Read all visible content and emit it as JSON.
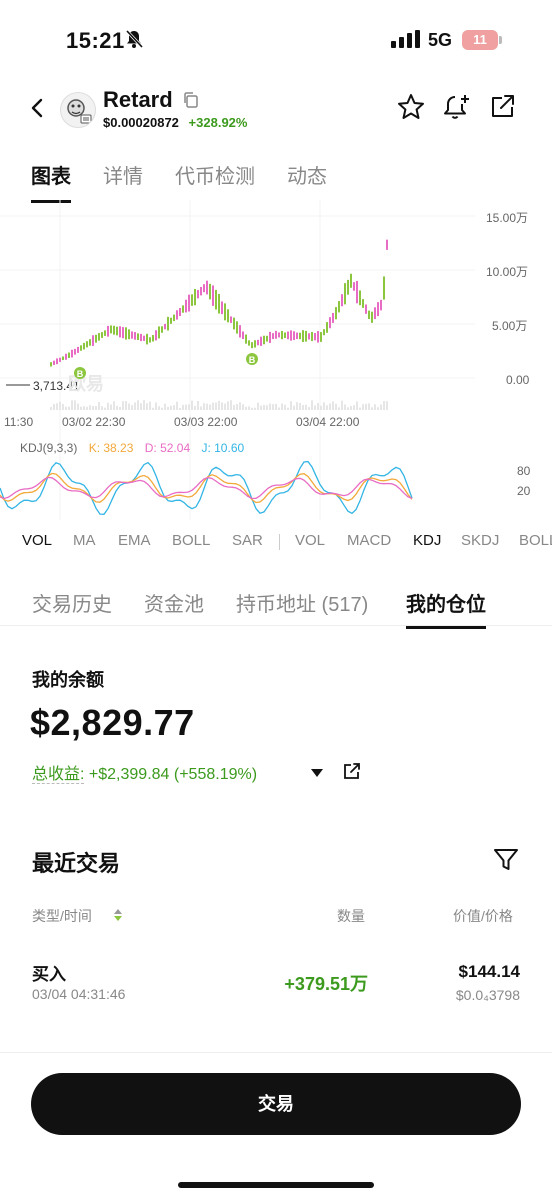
{
  "status_bar": {
    "time": "15:21",
    "network": "5G",
    "battery": "11"
  },
  "header": {
    "token_name": "Retard",
    "price": "$0.00020872",
    "change": "+328.92%"
  },
  "tabs": [
    {
      "label": "图表",
      "active": true
    },
    {
      "label": "详情",
      "active": false
    },
    {
      "label": "代币检测",
      "active": false
    },
    {
      "label": "动态",
      "active": false
    }
  ],
  "chart": {
    "y_ticks": [
      "15.00万",
      "10.00万",
      "5.00万",
      "0.00"
    ],
    "x_ticks": [
      "11:30",
      "03/02 22:30",
      "03/03 22:00",
      "03/04 22:00"
    ],
    "current_line_label": "3,713.41",
    "watermark": "欧易",
    "buy_marker": "B",
    "kdj": {
      "label": "KDJ(9,3,3)",
      "k": "K: 38.23",
      "d": "D: 52.04",
      "j": "J: 10.60",
      "levels": [
        "80",
        "20"
      ]
    },
    "colors": {
      "up": "#8cc63f",
      "down": "#e86bc4",
      "k": "#f2a93b",
      "d": "#e86bc4",
      "j": "#33b5e5",
      "buy": "#8cc63f"
    }
  },
  "chart_data": {
    "type": "line",
    "title": "",
    "xlabel": "",
    "ylabel": "",
    "x": [
      "11:30",
      "03/02 22:30",
      "03/03 22:00",
      "03/04 22:00"
    ],
    "ylim": [
      0,
      160000
    ],
    "series": [
      {
        "values": [
          3713,
          30000,
          60000,
          50000,
          70000,
          150000
        ]
      }
    ]
  },
  "indicator_tabs": {
    "main": [
      "VOL",
      "MA",
      "EMA",
      "BOLL",
      "SAR"
    ],
    "sub": [
      "VOL",
      "MACD",
      "KDJ",
      "SKDJ",
      "BOLL"
    ],
    "active_main": "VOL",
    "active_sub": "KDJ"
  },
  "section_tabs": [
    {
      "label": "交易历史",
      "active": false
    },
    {
      "label": "资金池",
      "active": false
    },
    {
      "label": "持币地址 (517)",
      "active": false
    },
    {
      "label": "我的仓位",
      "active": true
    }
  ],
  "position": {
    "balance_label": "我的余额",
    "balance": "$2,829.77",
    "pnl_label": "总收益:",
    "pnl_value": "+$2,399.84 (+558.19%)"
  },
  "recent_trades": {
    "title": "最近交易",
    "headers": {
      "type_time": "类型/时间",
      "qty": "数量",
      "value_price": "价值/价格"
    },
    "rows": [
      {
        "type": "买入",
        "time": "03/04 04:31:46",
        "qty": "+379.51万",
        "value": "$144.14",
        "price": "$0.0₄3798"
      }
    ]
  },
  "trade_button": "交易"
}
